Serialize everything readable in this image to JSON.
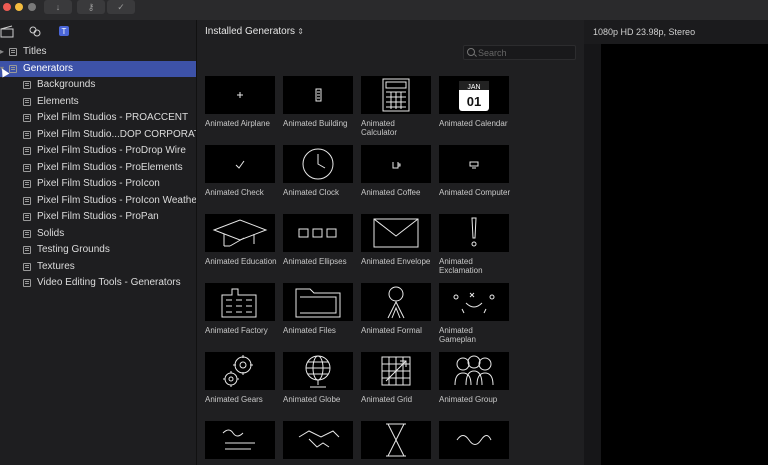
{
  "titlebar": {
    "buttons": [
      "download-icon",
      "key-icon",
      "check-icon"
    ]
  },
  "sidebar": {
    "items": [
      {
        "label": "Titles",
        "selected": false
      },
      {
        "label": "Generators",
        "selected": true
      },
      {
        "label": "Backgrounds",
        "selected": false
      },
      {
        "label": "Elements",
        "selected": false
      },
      {
        "label": "Pixel Film Studios - PROACCENT",
        "selected": false
      },
      {
        "label": "Pixel Film Studio...DOP CORPORATE",
        "selected": false
      },
      {
        "label": "Pixel Film Studios - ProDrop Wire",
        "selected": false
      },
      {
        "label": "Pixel Film Studios - ProElements",
        "selected": false
      },
      {
        "label": "Pixel Film Studios - ProIcon",
        "selected": false
      },
      {
        "label": "Pixel Film Studios - ProIcon Weather",
        "selected": false
      },
      {
        "label": "Pixel Film Studios - ProPan",
        "selected": false
      },
      {
        "label": "Solids",
        "selected": false
      },
      {
        "label": "Testing Grounds",
        "selected": false
      },
      {
        "label": "Textures",
        "selected": false
      },
      {
        "label": "Video Editing Tools - Generators",
        "selected": false
      }
    ]
  },
  "main": {
    "title": "Installed Generators",
    "search_placeholder": "Search",
    "tiles": [
      {
        "label": "Animated Airplane",
        "icon": "airplane-icon"
      },
      {
        "label": "Animated Building",
        "icon": "building-icon"
      },
      {
        "label": "Animated Calculator",
        "icon": "calculator-icon"
      },
      {
        "label": "Animated Calendar",
        "icon": "calendar-icon",
        "cal_month": "JAN",
        "cal_day": "01"
      },
      {
        "label": "Animated Check",
        "icon": "check-icon"
      },
      {
        "label": "Animated Clock",
        "icon": "clock-icon"
      },
      {
        "label": "Animated Coffee",
        "icon": "coffee-icon"
      },
      {
        "label": "Animated Computer",
        "icon": "computer-icon"
      },
      {
        "label": "Animated Education",
        "icon": "education-icon"
      },
      {
        "label": "Animated Ellipses",
        "icon": "ellipses-icon"
      },
      {
        "label": "Animated Envelope",
        "icon": "envelope-icon"
      },
      {
        "label": "Animated Exclamation",
        "icon": "exclamation-icon"
      },
      {
        "label": "Animated Factory",
        "icon": "factory-icon"
      },
      {
        "label": "Animated Files",
        "icon": "files-icon"
      },
      {
        "label": "Animated Formal",
        "icon": "formal-icon"
      },
      {
        "label": "Animated Gameplan",
        "icon": "gameplan-icon"
      },
      {
        "label": "Animated Gears",
        "icon": "gears-icon"
      },
      {
        "label": "Animated Globe",
        "icon": "globe-icon"
      },
      {
        "label": "Animated Grid",
        "icon": "grid-icon"
      },
      {
        "label": "Animated Group",
        "icon": "group-icon"
      },
      {
        "label": "",
        "icon": "handwriting-icon"
      },
      {
        "label": "",
        "icon": "handshake-icon"
      },
      {
        "label": "",
        "icon": "hourglass-icon"
      },
      {
        "label": "",
        "icon": "infinity-icon"
      }
    ]
  },
  "viewer": {
    "format": "1080p HD 23.98p, Stereo"
  }
}
